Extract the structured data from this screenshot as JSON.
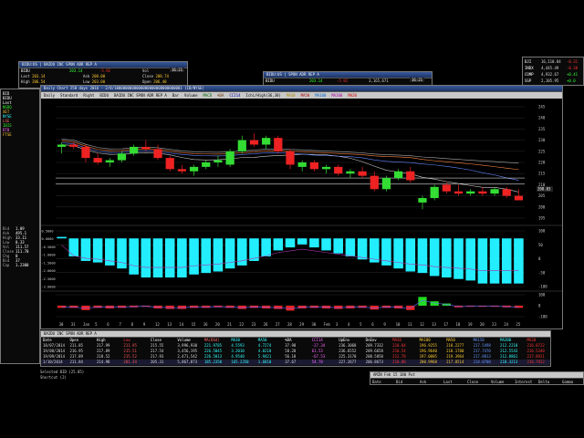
{
  "ticker_windows": {
    "left": {
      "title": "BIDU:US | BAIDU INC SPON ADR REP A",
      "symbol": "BIDU",
      "last": "203.14",
      "change": "-5.92",
      "vol_label": "Vol",
      "time_box": "16:21",
      "rows": [
        {
          "label": "Last",
          "value": "203.14",
          "label2": "Ask",
          "value2": "208.00",
          "label3": "Close",
          "value3": "208.74"
        },
        {
          "label": "High",
          "value": "206.54",
          "label2": "Low",
          "value2": "203.00",
          "label3": "Open",
          "value3": "206.40"
        }
      ]
    },
    "middle": {
      "title": "BIDU:US | SPON ADR REP A",
      "symbol": "BIDU",
      "last": "203.14",
      "change": "-5.92",
      "vol": "3,165,671",
      "time_box": "16:21"
    },
    "right_indices": [
      {
        "name": "DJI",
        "value": "16,110.84",
        "change": "-0.31"
      },
      {
        "name": "INDX",
        "value": "4,445.49",
        "change": "-0.38"
      },
      {
        "name": "COMP",
        "value": "4,932.67",
        "change": "+0.41"
      },
      {
        "name": "SSP",
        "value": "2,105.95",
        "change": "+0.0"
      }
    ]
  },
  "chart_window": {
    "title": "Daily Chart 250 days 2016 - 2/8/1000000000000000000000000000001 (IB/NYSE)",
    "toolbar": [
      "Daily",
      "Standard",
      "Right",
      "BIDU",
      "BAIDU INC SPON ADR REP A",
      "Bar",
      "Volume",
      "MACD",
      "%DA",
      "CCI14",
      "Ichi/High(36,38)",
      "MA30",
      "MA50",
      "MA100",
      "MA200",
      "MA20"
    ],
    "left_menu": [
      "BID",
      "BIDU",
      "Last",
      "NSDQ",
      "XET",
      "NYSE",
      "LSE",
      "IBIS",
      "DTB",
      "FTSE"
    ],
    "price_axis": [
      "245",
      "240",
      "235",
      "230",
      "225",
      "220",
      "215",
      "210",
      "205",
      "200",
      "195"
    ],
    "osc_axis": [
      "100",
      "50",
      "0",
      "-50",
      "-100"
    ],
    "cci_axis": [
      "100",
      "0",
      "-100"
    ],
    "date_axis": [
      "30",
      "31",
      "Jan",
      "5",
      "6",
      "7",
      "8",
      "9",
      "12",
      "13",
      "14",
      "15",
      "16",
      "20",
      "21",
      "22",
      "23",
      "26",
      "27",
      "28",
      "29",
      "30",
      "Feb",
      "3",
      "4",
      "5",
      "6",
      "9",
      "10",
      "11",
      "12",
      "13",
      "17",
      "18",
      "19",
      "20",
      "23",
      "24",
      "25"
    ],
    "last_price_tag": "208.03",
    "fib_axis": [
      "0.5000",
      "0.0000",
      "-0.5000",
      "-1.0000",
      "-1.5000",
      "-2.0000",
      "-2.5000",
      "-3.0000"
    ]
  },
  "chart_data": {
    "type": "candlestick",
    "title": "BIDU BAIDU INC SPON ADR REP A",
    "ylim": [
      195,
      245
    ],
    "x": [
      "Dec 30",
      "Dec 31",
      "Jan 2",
      "Jan 5",
      "Jan 6",
      "Jan 7",
      "Jan 8",
      "Jan 9",
      "Jan 12",
      "Jan 13",
      "Jan 14",
      "Jan 15",
      "Jan 16",
      "Jan 20",
      "Jan 21",
      "Jan 22",
      "Jan 23",
      "Jan 26",
      "Jan 27",
      "Jan 28",
      "Jan 29",
      "Jan 30",
      "Feb 2",
      "Feb 3",
      "Feb 4",
      "Feb 5",
      "Feb 6",
      "Feb 9",
      "Feb 10",
      "Feb 11",
      "Feb 12",
      "Feb 13",
      "Feb 17",
      "Feb 18",
      "Feb 19",
      "Feb 20",
      "Feb 23",
      "Feb 24",
      "Feb 25"
    ],
    "candles": [
      {
        "o": 227,
        "h": 229,
        "l": 224,
        "c": 228
      },
      {
        "o": 228,
        "h": 229,
        "l": 226,
        "c": 227
      },
      {
        "o": 227,
        "h": 228,
        "l": 220,
        "c": 222
      },
      {
        "o": 222,
        "h": 224,
        "l": 219,
        "c": 220
      },
      {
        "o": 220,
        "h": 222,
        "l": 218,
        "c": 221
      },
      {
        "o": 221,
        "h": 225,
        "l": 220,
        "c": 224
      },
      {
        "o": 224,
        "h": 228,
        "l": 223,
        "c": 227
      },
      {
        "o": 227,
        "h": 230,
        "l": 225,
        "c": 226
      },
      {
        "o": 226,
        "h": 228,
        "l": 221,
        "c": 222
      },
      {
        "o": 222,
        "h": 223,
        "l": 216,
        "c": 217
      },
      {
        "o": 217,
        "h": 219,
        "l": 215,
        "c": 216
      },
      {
        "o": 216,
        "h": 219,
        "l": 214,
        "c": 218
      },
      {
        "o": 218,
        "h": 221,
        "l": 217,
        "c": 220
      },
      {
        "o": 220,
        "h": 223,
        "l": 218,
        "c": 221
      },
      {
        "o": 219,
        "h": 226,
        "l": 218,
        "c": 225
      },
      {
        "o": 225,
        "h": 232,
        "l": 224,
        "c": 230
      },
      {
        "o": 230,
        "h": 233,
        "l": 227,
        "c": 228
      },
      {
        "o": 228,
        "h": 232,
        "l": 226,
        "c": 231
      },
      {
        "o": 231,
        "h": 232,
        "l": 224,
        "c": 225
      },
      {
        "o": 225,
        "h": 226,
        "l": 217,
        "c": 219
      },
      {
        "o": 218,
        "h": 221,
        "l": 216,
        "c": 220
      },
      {
        "o": 220,
        "h": 221,
        "l": 216,
        "c": 217
      },
      {
        "o": 217,
        "h": 219,
        "l": 215,
        "c": 218
      },
      {
        "o": 218,
        "h": 219,
        "l": 214,
        "c": 215
      },
      {
        "o": 215,
        "h": 217,
        "l": 213,
        "c": 216
      },
      {
        "o": 216,
        "h": 218,
        "l": 213,
        "c": 214
      },
      {
        "o": 214,
        "h": 216,
        "l": 207,
        "c": 208
      },
      {
        "o": 208,
        "h": 214,
        "l": 207,
        "c": 213
      },
      {
        "o": 213,
        "h": 217,
        "l": 212,
        "c": 216
      },
      {
        "o": 216,
        "h": 218,
        "l": 211,
        "c": 212
      },
      {
        "o": 202,
        "h": 205,
        "l": 199,
        "c": 204
      },
      {
        "o": 204,
        "h": 210,
        "l": 203,
        "c": 209
      },
      {
        "o": 210,
        "h": 211,
        "l": 206,
        "c": 207
      },
      {
        "o": 207,
        "h": 210,
        "l": 205,
        "c": 206
      },
      {
        "o": 206,
        "h": 208,
        "l": 205,
        "c": 207
      },
      {
        "o": 207,
        "h": 209,
        "l": 205,
        "c": 206
      },
      {
        "o": 206,
        "h": 209,
        "l": 205,
        "c": 208
      },
      {
        "o": 208,
        "h": 209,
        "l": 204,
        "c": 205
      },
      {
        "o": 205,
        "h": 208,
        "l": 203,
        "c": 203
      }
    ],
    "osc_values": [
      0.1,
      -1.2,
      -1.5,
      -1.6,
      -1.8,
      -2.0,
      -2.4,
      -2.6,
      -2.6,
      -2.6,
      -2.6,
      -2.4,
      -2.3,
      -2.2,
      -2.0,
      -1.8,
      -1.5,
      -1.2,
      -0.8,
      -0.6,
      -0.4,
      -0.6,
      -0.8,
      -1.0,
      -1.2,
      -1.4,
      -1.6,
      -1.8,
      -2.0,
      -2.2,
      -2.3,
      -2.5,
      -2.6,
      -2.7,
      -2.8,
      -3.0,
      -3.0,
      -3.0,
      -3.0
    ],
    "vol_values": [
      -20,
      -20,
      -40,
      -20,
      -25,
      -20,
      -15,
      -10,
      -25,
      -30,
      -30,
      -20,
      -20,
      -15,
      -20,
      -30,
      -20,
      -25,
      -30,
      -45,
      -25,
      -20,
      -25,
      -30,
      -25,
      -20,
      -35,
      -20,
      -25,
      -40,
      80,
      40,
      20,
      -15,
      -10,
      -10,
      -10,
      -15,
      -20
    ]
  },
  "bottom_table": {
    "title": "BAIDU INC SPON ADR REP A",
    "headers": [
      "Date",
      "Open",
      "High",
      "Low",
      "Close",
      "Volume",
      "MA(D6d)",
      "MA30",
      "MA50",
      "%DA",
      "CCI14",
      "UpEnv",
      "DnEnv",
      "MA20",
      "MA100",
      "MA50",
      "MA150",
      "MA200",
      "MA20"
    ],
    "rows": [
      [
        "18/07/2014",
        "211.85",
        "217.99",
        "211.95",
        "215.55",
        "3,996,930",
        "221.9785",
        "4.5593",
        "4.7274",
        "37.98",
        "-27.34",
        "236.3068",
        "209.7332",
        "210.04",
        "196.9255",
        "218.2277",
        "217.5498",
        "212.2218",
        "216.8722"
      ],
      [
        "19/08/2014",
        "216.95",
        "217.89",
        "215.51",
        "217.54",
        "3,456,195",
        "226.5045",
        "3.2010",
        "4.8210",
        "58.28",
        "61.53",
        "236.6552",
        "209.6658",
        "210.54",
        "196.9640",
        "218.1780",
        "217.7470",
        "212.5543",
        "216.5340"
      ],
      [
        "19/09/2014",
        "217.89",
        "218.52",
        "215.52",
        "217.93",
        "2,471,542",
        "226.5013",
        "4.9540",
        "5.9421",
        "56.18",
        "-67.53",
        "225.3170",
        "208.5850",
        "212.78",
        "197.0005",
        "219.3964",
        "217.8813",
        "212.8861",
        "217.8921"
      ],
      [
        "1/10/2014",
        "211.84",
        "214.98",
        "201.34",
        "205.31",
        "5,867,873",
        "185.2350",
        "165.2350",
        "1.6810",
        "37.67",
        "54.78",
        "227.2677",
        "206.8673",
        "210.00",
        "200.9968",
        "217.8514",
        "214.0700",
        "218.3213",
        "216.7922"
      ]
    ],
    "status": "Selected  BID (25.85)",
    "status2": "Shortcut (2)"
  },
  "small_bottom_window": {
    "title": "AMZN  Feb 15  180 Put",
    "headers": [
      "Date",
      "Bid",
      "Ask",
      "Last",
      "Close",
      "Volume",
      "Interest",
      "Delta",
      "Gamma"
    ]
  },
  "left_panel": {
    "values": [
      "1.09",
      "495.1",
      "33.11",
      "0.33",
      "111.57",
      "111.70",
      "0",
      "37",
      "1.2300"
    ],
    "labels": [
      "Bid",
      "Ask",
      "High",
      "Low",
      "Vol",
      "Close",
      "Chg",
      "Bid",
      "Cap"
    ]
  },
  "colors": {
    "up_candle": "#33dd33",
    "down_candle": "#ee2222",
    "osc_bar": "#22eeff",
    "vol_up": "#22dd22",
    "vol_down": "#ee2222",
    "grid": "#2a2a2a"
  }
}
